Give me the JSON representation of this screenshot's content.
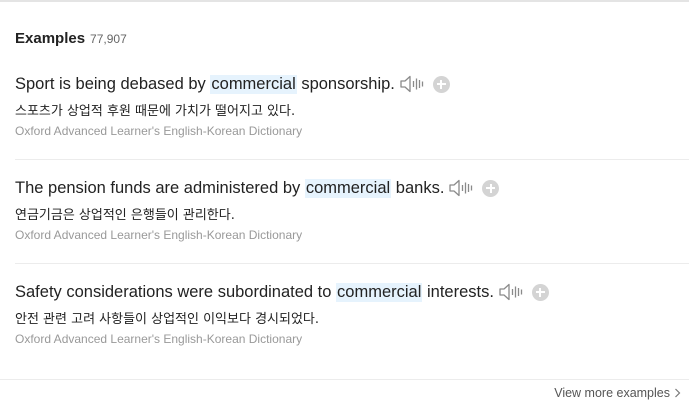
{
  "header": {
    "title": "Examples",
    "count": "77,907"
  },
  "examples": [
    {
      "before": "Sport is being debased by ",
      "keyword": "commercial",
      "after": " sponsorship.",
      "translation": "스포츠가 상업적 후원 때문에 가치가 떨어지고 있다.",
      "source": "Oxford Advanced Learner's English-Korean Dictionary"
    },
    {
      "before": "The pension funds are administered by ",
      "keyword": "commercial",
      "after": " banks.",
      "translation": "연금기금은 상업적인 은행들이 관리한다.",
      "source": "Oxford Advanced Learner's English-Korean Dictionary"
    },
    {
      "before": "Safety considerations were subordinated to ",
      "keyword": "commercial",
      "after": " interests.",
      "translation": "안전 관련 고려 사항들이 상업적인 이익보다 경시되었다.",
      "source": "Oxford Advanced Learner's English-Korean Dictionary"
    }
  ],
  "footer": {
    "view_more_label": "View more examples"
  },
  "icons": {
    "sound": "speaker-icon",
    "add": "plus-circle-icon",
    "more": "chevron-right-icon"
  },
  "colors": {
    "keyword_highlight": "#e6f3fd",
    "add_button": "#d4d4d4"
  }
}
